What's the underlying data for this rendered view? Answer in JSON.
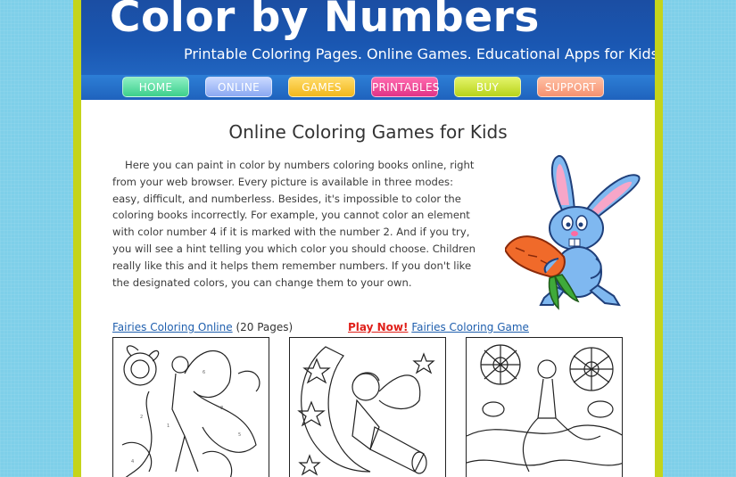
{
  "header": {
    "title": "Color by Numbers",
    "tagline": "Printable Coloring Pages. Online Games. Educational Apps for Kids."
  },
  "nav": {
    "home": "HOME",
    "online": "ONLINE",
    "games": "GAMES",
    "printables": "PRINTABLES",
    "buy": "BUY",
    "support": "SUPPORT"
  },
  "nav_colors": {
    "home": "#3ccf8b",
    "online": "#8aa8f2",
    "games": "#f2b71c",
    "printables": "#e03287",
    "buy": "#b8d31a",
    "support": "#f59170"
  },
  "main": {
    "title": "Online Coloring Games for Kids",
    "intro": "Here you can paint in color by numbers coloring books online, right from your web browser. Every picture is available in three modes: easy, difficult, and numberless. Besides, it's impossible to color the coloring books incorrectly. For example, you cannot color an element with color number 4 if it is marked with the number 2. And if you try, you will see a hint telling you which color you should choose. Children really like this and it helps them remember numbers. If you don't like the designated colors, you can change them to your own."
  },
  "gallery": {
    "link1": "Fairies Coloring Online",
    "link1_count": "(20 Pages)",
    "play_now": "Play Now!",
    "link2": "Fairies Coloring Game"
  }
}
